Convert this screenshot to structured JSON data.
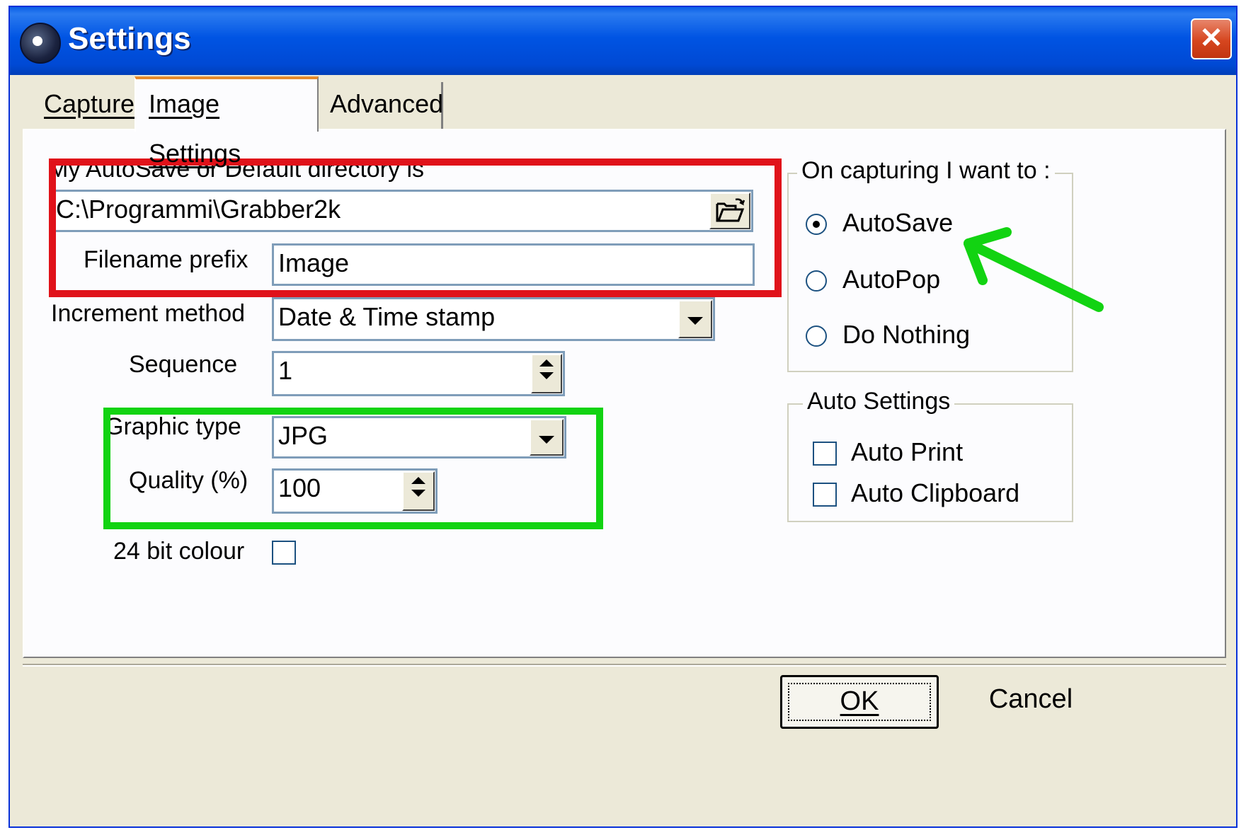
{
  "window": {
    "title": "Settings",
    "close_glyph": "✕"
  },
  "tabs": [
    {
      "label": "Capture"
    },
    {
      "label": "Image Settings",
      "active": true
    },
    {
      "label": "Advanced"
    }
  ],
  "directory": {
    "label": "My AutoSave or Default directory is",
    "value": "C:\\Programmi\\Grabber2k",
    "browse_icon": "folder-open-icon"
  },
  "filename_prefix": {
    "label": "Filename prefix",
    "value": "Image"
  },
  "increment_method": {
    "label": "Increment method",
    "value": "Date & Time stamp"
  },
  "sequence": {
    "label": "Sequence",
    "value": "1"
  },
  "graphic_type": {
    "label": "Graphic type",
    "value": "JPG"
  },
  "quality": {
    "label": "Quality (%)",
    "value": "100"
  },
  "bit_colour": {
    "label": "24 bit colour",
    "checked": false
  },
  "on_capturing": {
    "title": "On capturing I want to :",
    "options": [
      {
        "label": "AutoSave",
        "checked": true
      },
      {
        "label": "AutoPop",
        "checked": false
      },
      {
        "label": "Do Nothing",
        "checked": false
      }
    ]
  },
  "auto_settings": {
    "title": "Auto Settings",
    "options": [
      {
        "label": "Auto Print",
        "checked": false
      },
      {
        "label": "Auto Clipboard",
        "checked": false
      }
    ]
  },
  "buttons": {
    "ok": "OK",
    "cancel": "Cancel"
  },
  "annotations": {
    "red_box_color": "#e0121a",
    "green_box_color": "#12d312",
    "arrow_color": "#12d312"
  }
}
